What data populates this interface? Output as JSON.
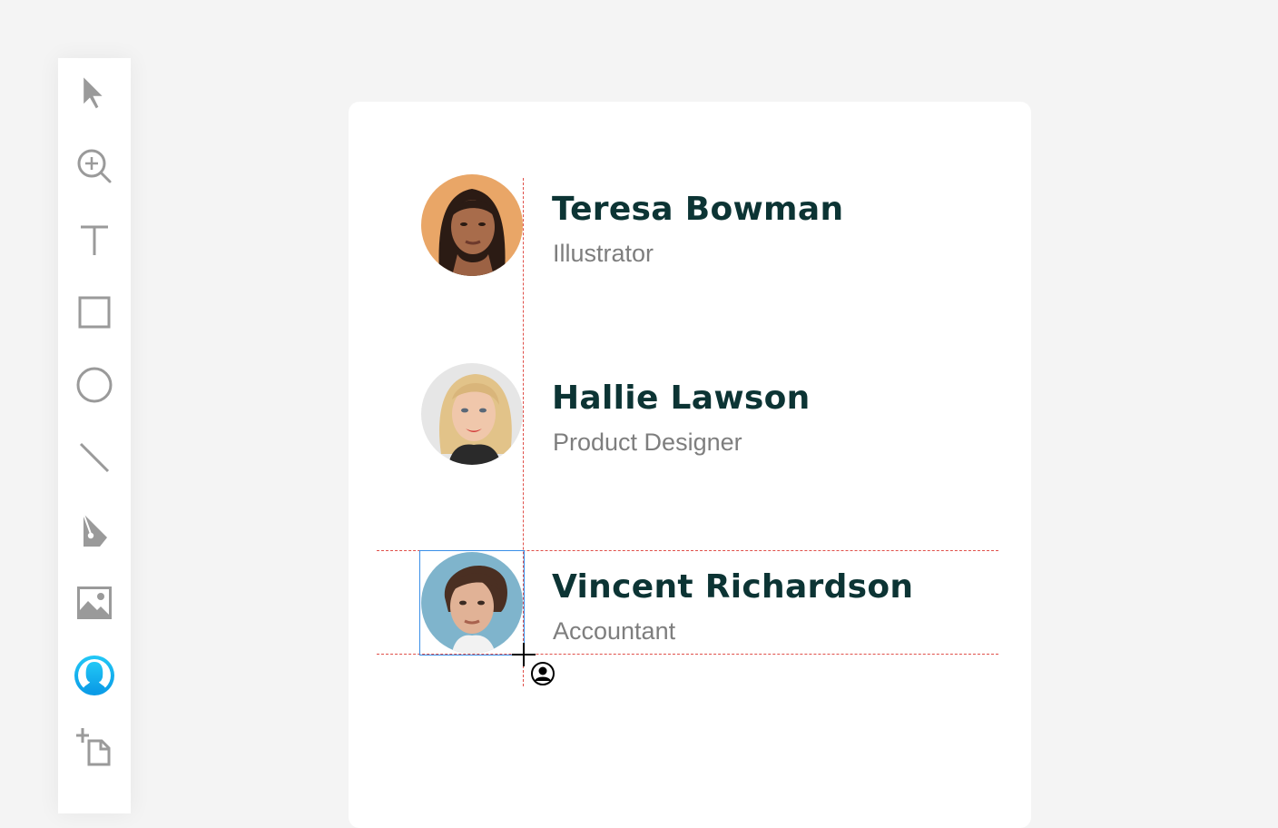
{
  "toolbar": {
    "tools": [
      {
        "name": "pointer-icon",
        "active": false
      },
      {
        "name": "zoom-icon",
        "active": false
      },
      {
        "name": "text-icon",
        "active": false
      },
      {
        "name": "rectangle-icon",
        "active": false
      },
      {
        "name": "ellipse-icon",
        "active": false
      },
      {
        "name": "line-icon",
        "active": false
      },
      {
        "name": "pen-icon",
        "active": false
      },
      {
        "name": "image-icon",
        "active": false
      },
      {
        "name": "avatar-icon",
        "active": true
      },
      {
        "name": "artboard-icon",
        "active": false
      }
    ],
    "icon_color": "#9a9a9a",
    "active_color": "#18b4f0"
  },
  "people": [
    {
      "name": "Teresa Bowman",
      "role": "Illustrator"
    },
    {
      "name": "Hallie Lawson",
      "role": "Product Designer"
    },
    {
      "name": "Vincent Richardson",
      "role": "Accountant"
    }
  ],
  "colors": {
    "name": "#0c3434",
    "role": "#7e7e7e",
    "guide": "#e0504a",
    "selection": "#3a8fe8"
  }
}
